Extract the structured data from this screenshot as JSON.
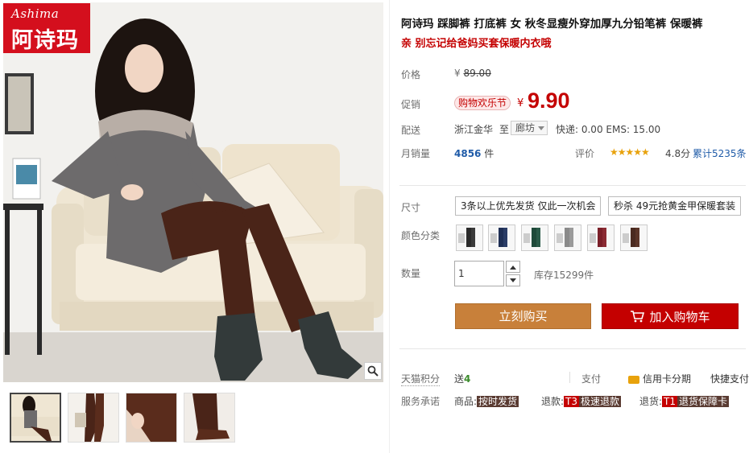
{
  "gallery": {
    "brand_en": "Ashima",
    "brand_cn": "阿诗玛",
    "zoom_icon": "magnifier-icon",
    "thumbnails": [
      "thumb-1",
      "thumb-2",
      "thumb-3",
      "thumb-4"
    ]
  },
  "product": {
    "title": "阿诗玛 踩脚裤 打底裤 女 秋冬显瘦外穿加厚九分铅笔裤 保暖裤",
    "subtitle": "亲 别忘记给爸妈买套保暖内衣哦",
    "price_label": "价格",
    "currency": "¥",
    "original_price": "89.00",
    "promo_label": "促销",
    "promo_tag": "购物欢乐节",
    "promo_price": "9.90",
    "shipping_label": "配送",
    "shipping_from": "浙江金华",
    "shipping_to_word": "至",
    "shipping_dest": "廊坊",
    "shipping_cost": "快递: 0.00 EMS: 15.00",
    "sales_label": "月销量",
    "monthly_sales": "4856",
    "sales_unit": "件",
    "rating_label": "评价",
    "stars": "★★★★★",
    "rating": "4.8分",
    "review_count": "累计5235条"
  },
  "options": {
    "size_label": "尺寸",
    "sizes": [
      "3条以上优先发货 仅此一次机会",
      "秒杀 49元抢黄金甲保暖套装"
    ],
    "color_label": "颜色分类",
    "colors": [
      "#2a2a2a",
      "#1f2f55",
      "#1f4a3a",
      "#8a8a8a",
      "#7a1f28",
      "#4a2a20"
    ],
    "qty_label": "数量",
    "qty_value": "1",
    "stock": "库存15299件"
  },
  "actions": {
    "buy_now": "立刻购买",
    "add_to_cart": "加入购物车"
  },
  "services": {
    "points_label": "天猫积分",
    "points_send": "送",
    "points_value": "4",
    "pay_label": "支付",
    "credit_label": "信用卡分期",
    "quick_pay": "快捷支付",
    "promise_label": "服务承诺",
    "goods_label": "商品:",
    "goods_tag": "按时发货",
    "refund_label": "退款:",
    "refund_code": "T3",
    "refund_tag": "极速退款",
    "return_label": "退货:",
    "return_code": "T1",
    "return_tag": "退货保障卡"
  }
}
